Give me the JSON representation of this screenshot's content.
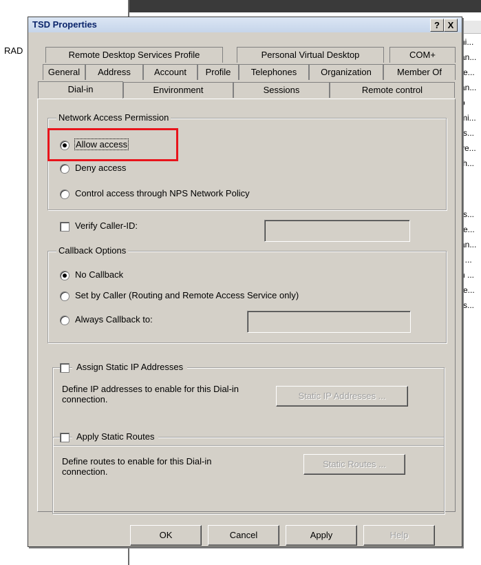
{
  "background": {
    "rad_label": "RAD",
    "list_items": [
      "ni...",
      "an...",
      "re...",
      "an...",
      "p",
      "mi...",
      "rs...",
      "ve...",
      "th...",
      "rs...",
      "re...",
      "an...",
      "t ...",
      "n ...",
      "re...",
      "rs..."
    ]
  },
  "dialog": {
    "title": "TSD Properties",
    "help_btn": "?",
    "close_btn": "X",
    "tabs_row1": [
      "Remote Desktop Services Profile",
      "Personal Virtual Desktop",
      "COM+"
    ],
    "tabs_row2": [
      "General",
      "Address",
      "Account",
      "Profile",
      "Telephones",
      "Organization",
      "Member Of"
    ],
    "tabs_row3": [
      "Dial-in",
      "Environment",
      "Sessions",
      "Remote control"
    ]
  },
  "network_access": {
    "legend": "Network Access Permission",
    "allow": "Allow access",
    "deny": "Deny access",
    "control": "Control access through NPS Network Policy",
    "selected": "allow"
  },
  "verify_caller_id": {
    "label": "Verify Caller-ID:",
    "checked": false,
    "value": ""
  },
  "callback": {
    "legend": "Callback Options",
    "no_callback": "No Callback",
    "set_by_caller": "Set by Caller (Routing and Remote Access Service only)",
    "always_callback": "Always Callback to:",
    "selected": "no_callback",
    "always_value": ""
  },
  "static_ip": {
    "label": "Assign Static IP Addresses",
    "checked": false,
    "description": "Define IP addresses to enable for this Dial-in connection.",
    "button": "Static IP Addresses ..."
  },
  "static_routes": {
    "label": "Apply Static Routes",
    "checked": false,
    "description": "Define routes to enable for this Dial-in connection.",
    "button": "Static Routes ..."
  },
  "buttons": {
    "ok": "OK",
    "cancel": "Cancel",
    "apply": "Apply",
    "help": "Help"
  },
  "colors": {
    "highlight": "#e8141b",
    "dialog_bg": "#d4d0c8",
    "title_text": "#0a246a"
  }
}
